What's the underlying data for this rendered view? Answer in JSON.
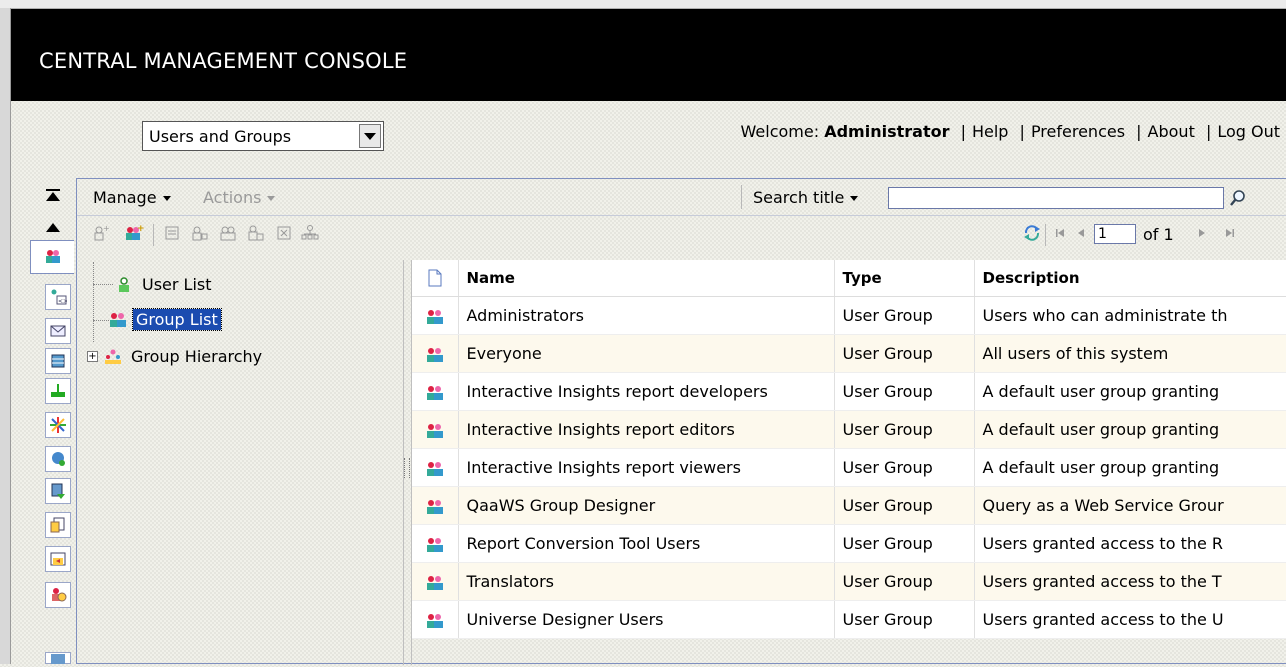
{
  "app": {
    "title": "CENTRAL MANAGEMENT CONSOLE"
  },
  "section_select": {
    "value": "Users and Groups"
  },
  "header_links": {
    "welcome_prefix": "Welcome:",
    "user": "Administrator",
    "separator": "|",
    "help": "Help",
    "preferences": "Preferences",
    "about": "About",
    "logout": "Log Out"
  },
  "nav_icons": [
    "users-groups",
    "servers",
    "inbox",
    "databases",
    "connections",
    "events",
    "federation",
    "replication",
    "applications",
    "folders",
    "access-levels",
    "calendars"
  ],
  "toolbar": {
    "manage": "Manage",
    "actions": "Actions",
    "search_label": "Search title",
    "search_value": ""
  },
  "pager": {
    "page": "1",
    "of_label": "of 1"
  },
  "tree": {
    "items": [
      {
        "label": "User List",
        "icon": "user-icon"
      },
      {
        "label": "Group List",
        "icon": "group-icon",
        "selected": true
      },
      {
        "label": "Group Hierarchy",
        "icon": "hierarchy-icon"
      }
    ]
  },
  "table": {
    "columns": [
      "Name",
      "Type",
      "Description"
    ],
    "rows": [
      {
        "name": "Administrators",
        "type": "User Group",
        "description": "Users who can administrate th"
      },
      {
        "name": "Everyone",
        "type": "User Group",
        "description": "All users of this system"
      },
      {
        "name": "Interactive Insights report developers",
        "type": "User Group",
        "description": "A default user group granting"
      },
      {
        "name": "Interactive Insights report editors",
        "type": "User Group",
        "description": "A default user group granting"
      },
      {
        "name": "Interactive Insights report viewers",
        "type": "User Group",
        "description": "A default user group granting"
      },
      {
        "name": "QaaWS Group Designer",
        "type": "User Group",
        "description": "Query as a Web Service Grour"
      },
      {
        "name": "Report Conversion Tool Users",
        "type": "User Group",
        "description": "Users granted access to the R"
      },
      {
        "name": "Translators",
        "type": "User Group",
        "description": "Users granted access to the T"
      },
      {
        "name": "Universe Designer Users",
        "type": "User Group",
        "description": "Users granted access to the U"
      }
    ]
  },
  "colors": {
    "banner": "#000000",
    "selection": "#1b4cb0",
    "panel_border": "#7f8fbf",
    "row_alt": "#fdf9ed"
  }
}
